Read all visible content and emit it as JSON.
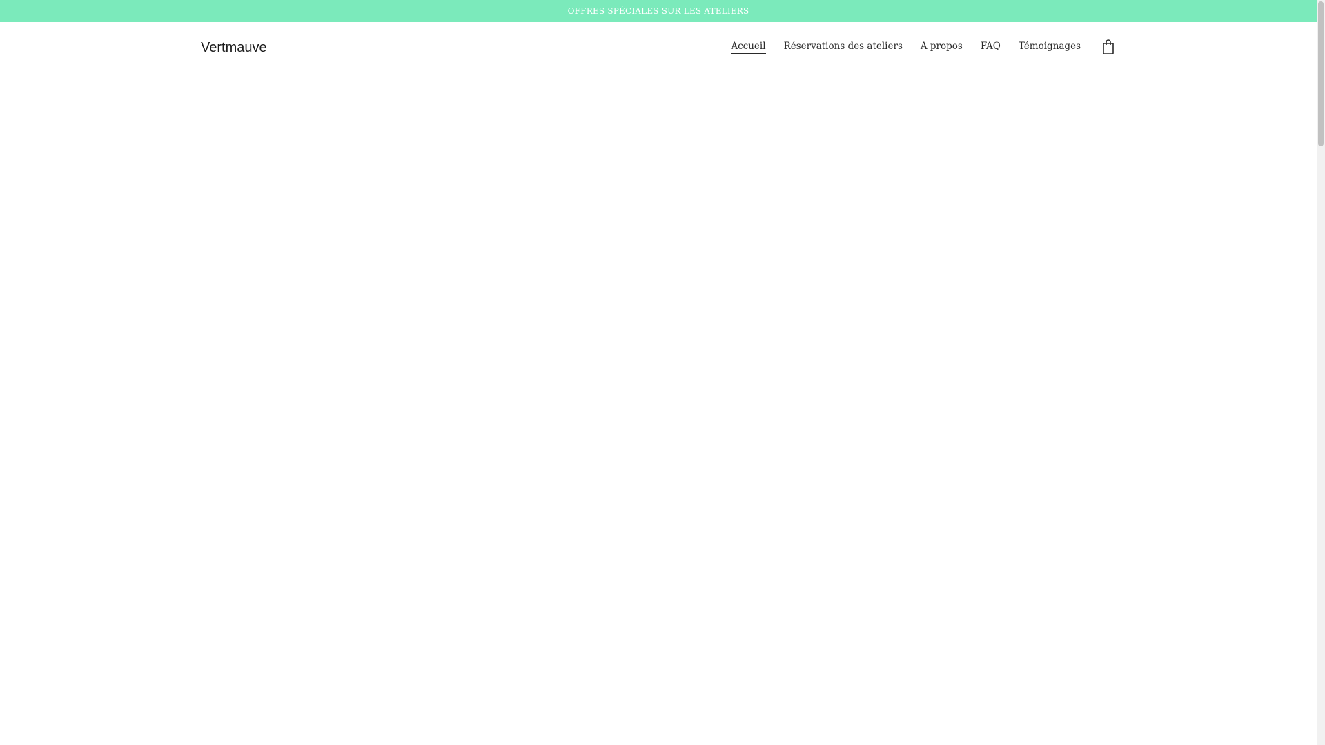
{
  "promo": {
    "text": "OFFRES SPÉCIALES SUR LES ATELIERS",
    "background": "#7beabb"
  },
  "header": {
    "logo": "Vertmauve",
    "nav": [
      {
        "label": "Accueil",
        "active": true
      },
      {
        "label": "Réservations des ateliers"
      },
      {
        "label": "A propos"
      },
      {
        "label": "FAQ"
      },
      {
        "label": "Témoignages"
      }
    ],
    "cart_icon": "shopping-bag-icon"
  }
}
